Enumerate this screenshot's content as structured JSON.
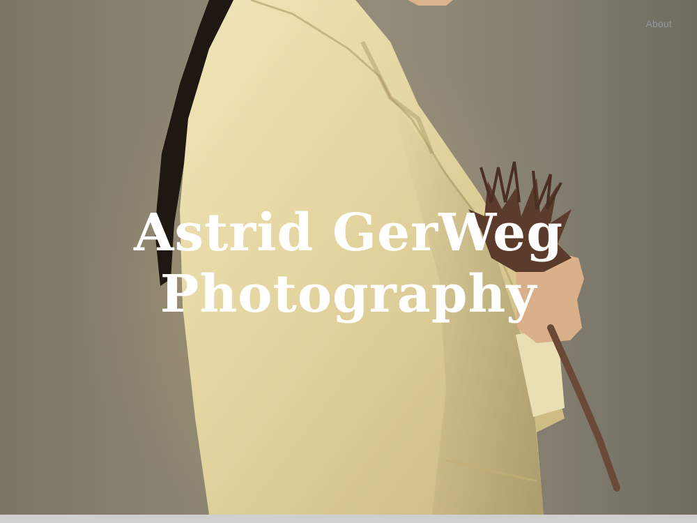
{
  "nav": {
    "about_label": "About"
  },
  "hero": {
    "title_line1": "Astrid GerWeg",
    "title_line2": "Photography",
    "image_subject": "woman-in-cream-jacket-holding-dried-flower"
  },
  "colors": {
    "background_warm": "#8a8370",
    "jacket": "#e7dba8",
    "hair": "#1e1712",
    "flower": "#5b3b2b",
    "nav_text": "#8e9ba3",
    "title_text": "#ffffff"
  }
}
